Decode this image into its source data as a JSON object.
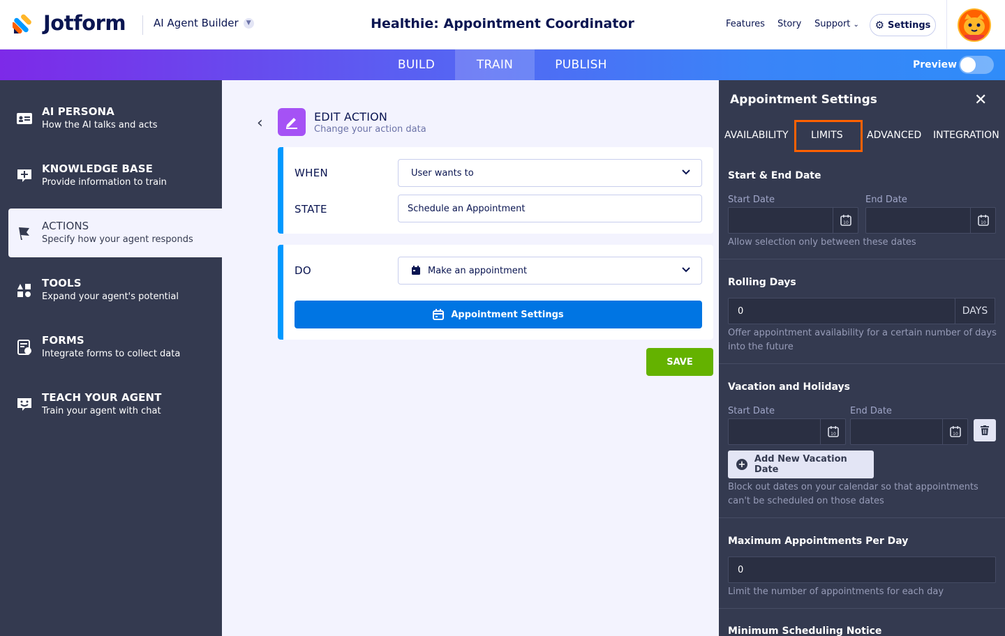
{
  "header": {
    "logo_text": "Jotform",
    "builder_label": "AI Agent Builder",
    "agent_title": "Healthie: Appointment Coordinator",
    "nav": [
      "Features",
      "Story",
      "Support"
    ],
    "settings_label": "Settings",
    "colors": {
      "accent_orange": "#ff6100",
      "brand_navy": "#0a1551"
    }
  },
  "tabs": {
    "items": [
      "BUILD",
      "TRAIN",
      "PUBLISH"
    ],
    "active": "TRAIN",
    "preview_label": "Preview"
  },
  "sidebar": {
    "items": [
      {
        "title": "AI PERSONA",
        "subtitle": "How the AI talks and acts",
        "icon": "id-card-icon"
      },
      {
        "title": "KNOWLEDGE BASE",
        "subtitle": "Provide information to train",
        "icon": "knowledge-add-icon"
      },
      {
        "title": "ACTIONS",
        "subtitle": "Specify how your agent responds",
        "icon": "flag-icon",
        "active": true
      },
      {
        "title": "TOOLS",
        "subtitle": "Expand your agent's potential",
        "icon": "tools-shapes-icon"
      },
      {
        "title": "FORMS",
        "subtitle": "Integrate forms to collect data",
        "icon": "form-icon"
      },
      {
        "title": "TEACH YOUR AGENT",
        "subtitle": "Train your agent with chat",
        "icon": "chat-smile-icon"
      }
    ]
  },
  "main": {
    "edit_title": "EDIT ACTION",
    "edit_subtitle": "Change your action data",
    "when_label": "WHEN",
    "when_value": "User wants to",
    "state_label": "STATE",
    "state_value": "Schedule an Appointment",
    "do_label": "DO",
    "do_value": "Make an appointment",
    "appt_settings_label": "Appointment Settings",
    "save_label": "SAVE"
  },
  "panel": {
    "title": "Appointment Settings",
    "tabs": [
      "AVAILABILITY",
      "LIMITS",
      "ADVANCED",
      "INTEGRATION"
    ],
    "active_tab": "LIMITS",
    "start_end": {
      "title": "Start & End Date",
      "start_label": "Start Date",
      "end_label": "End Date",
      "help": "Allow selection only between these dates"
    },
    "rolling": {
      "title": "Rolling Days",
      "value": "0",
      "unit": "DAYS",
      "help": "Offer appointment availability for a certain number of days into the future"
    },
    "vacation": {
      "title": "Vacation and Holidays",
      "start_label": "Start Date",
      "end_label": "End Date",
      "add_label": "Add New Vacation Date",
      "help": "Block out dates on your calendar so that appointments can't be scheduled on those dates"
    },
    "max_per_day": {
      "title": "Maximum Appointments Per Day",
      "value": "0",
      "help": "Limit the number of appointments for each day"
    },
    "min_notice": {
      "title": "Minimum Scheduling Notice"
    }
  }
}
